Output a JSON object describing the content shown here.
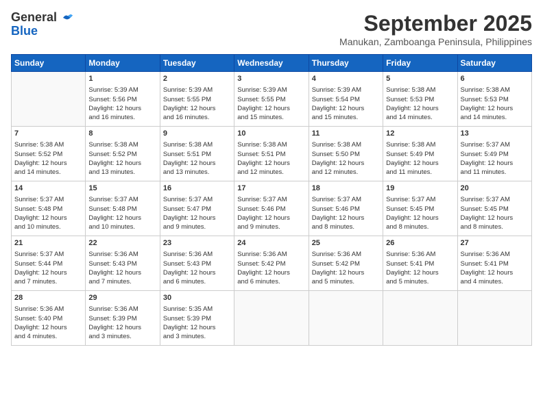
{
  "header": {
    "logo_general": "General",
    "logo_blue": "Blue",
    "month_title": "September 2025",
    "location": "Manukan, Zamboanga Peninsula, Philippines"
  },
  "weekdays": [
    "Sunday",
    "Monday",
    "Tuesday",
    "Wednesday",
    "Thursday",
    "Friday",
    "Saturday"
  ],
  "weeks": [
    [
      {
        "day": "",
        "info": ""
      },
      {
        "day": "1",
        "info": "Sunrise: 5:39 AM\nSunset: 5:56 PM\nDaylight: 12 hours\nand 16 minutes."
      },
      {
        "day": "2",
        "info": "Sunrise: 5:39 AM\nSunset: 5:55 PM\nDaylight: 12 hours\nand 16 minutes."
      },
      {
        "day": "3",
        "info": "Sunrise: 5:39 AM\nSunset: 5:55 PM\nDaylight: 12 hours\nand 15 minutes."
      },
      {
        "day": "4",
        "info": "Sunrise: 5:39 AM\nSunset: 5:54 PM\nDaylight: 12 hours\nand 15 minutes."
      },
      {
        "day": "5",
        "info": "Sunrise: 5:38 AM\nSunset: 5:53 PM\nDaylight: 12 hours\nand 14 minutes."
      },
      {
        "day": "6",
        "info": "Sunrise: 5:38 AM\nSunset: 5:53 PM\nDaylight: 12 hours\nand 14 minutes."
      }
    ],
    [
      {
        "day": "7",
        "info": "Sunrise: 5:38 AM\nSunset: 5:52 PM\nDaylight: 12 hours\nand 14 minutes."
      },
      {
        "day": "8",
        "info": "Sunrise: 5:38 AM\nSunset: 5:52 PM\nDaylight: 12 hours\nand 13 minutes."
      },
      {
        "day": "9",
        "info": "Sunrise: 5:38 AM\nSunset: 5:51 PM\nDaylight: 12 hours\nand 13 minutes."
      },
      {
        "day": "10",
        "info": "Sunrise: 5:38 AM\nSunset: 5:51 PM\nDaylight: 12 hours\nand 12 minutes."
      },
      {
        "day": "11",
        "info": "Sunrise: 5:38 AM\nSunset: 5:50 PM\nDaylight: 12 hours\nand 12 minutes."
      },
      {
        "day": "12",
        "info": "Sunrise: 5:38 AM\nSunset: 5:49 PM\nDaylight: 12 hours\nand 11 minutes."
      },
      {
        "day": "13",
        "info": "Sunrise: 5:37 AM\nSunset: 5:49 PM\nDaylight: 12 hours\nand 11 minutes."
      }
    ],
    [
      {
        "day": "14",
        "info": "Sunrise: 5:37 AM\nSunset: 5:48 PM\nDaylight: 12 hours\nand 10 minutes."
      },
      {
        "day": "15",
        "info": "Sunrise: 5:37 AM\nSunset: 5:48 PM\nDaylight: 12 hours\nand 10 minutes."
      },
      {
        "day": "16",
        "info": "Sunrise: 5:37 AM\nSunset: 5:47 PM\nDaylight: 12 hours\nand 9 minutes."
      },
      {
        "day": "17",
        "info": "Sunrise: 5:37 AM\nSunset: 5:46 PM\nDaylight: 12 hours\nand 9 minutes."
      },
      {
        "day": "18",
        "info": "Sunrise: 5:37 AM\nSunset: 5:46 PM\nDaylight: 12 hours\nand 8 minutes."
      },
      {
        "day": "19",
        "info": "Sunrise: 5:37 AM\nSunset: 5:45 PM\nDaylight: 12 hours\nand 8 minutes."
      },
      {
        "day": "20",
        "info": "Sunrise: 5:37 AM\nSunset: 5:45 PM\nDaylight: 12 hours\nand 8 minutes."
      }
    ],
    [
      {
        "day": "21",
        "info": "Sunrise: 5:37 AM\nSunset: 5:44 PM\nDaylight: 12 hours\nand 7 minutes."
      },
      {
        "day": "22",
        "info": "Sunrise: 5:36 AM\nSunset: 5:43 PM\nDaylight: 12 hours\nand 7 minutes."
      },
      {
        "day": "23",
        "info": "Sunrise: 5:36 AM\nSunset: 5:43 PM\nDaylight: 12 hours\nand 6 minutes."
      },
      {
        "day": "24",
        "info": "Sunrise: 5:36 AM\nSunset: 5:42 PM\nDaylight: 12 hours\nand 6 minutes."
      },
      {
        "day": "25",
        "info": "Sunrise: 5:36 AM\nSunset: 5:42 PM\nDaylight: 12 hours\nand 5 minutes."
      },
      {
        "day": "26",
        "info": "Sunrise: 5:36 AM\nSunset: 5:41 PM\nDaylight: 12 hours\nand 5 minutes."
      },
      {
        "day": "27",
        "info": "Sunrise: 5:36 AM\nSunset: 5:41 PM\nDaylight: 12 hours\nand 4 minutes."
      }
    ],
    [
      {
        "day": "28",
        "info": "Sunrise: 5:36 AM\nSunset: 5:40 PM\nDaylight: 12 hours\nand 4 minutes."
      },
      {
        "day": "29",
        "info": "Sunrise: 5:36 AM\nSunset: 5:39 PM\nDaylight: 12 hours\nand 3 minutes."
      },
      {
        "day": "30",
        "info": "Sunrise: 5:35 AM\nSunset: 5:39 PM\nDaylight: 12 hours\nand 3 minutes."
      },
      {
        "day": "",
        "info": ""
      },
      {
        "day": "",
        "info": ""
      },
      {
        "day": "",
        "info": ""
      },
      {
        "day": "",
        "info": ""
      }
    ]
  ]
}
